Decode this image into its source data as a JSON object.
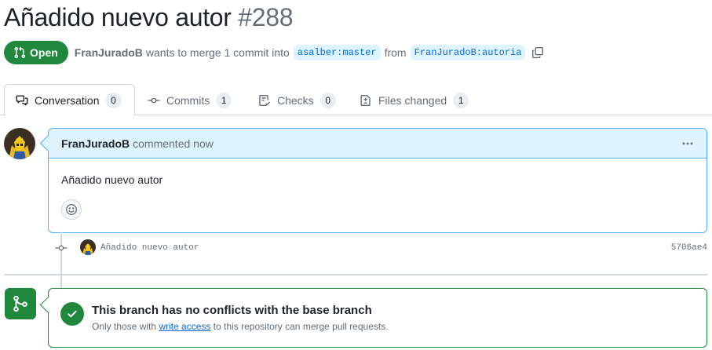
{
  "pr": {
    "title": "Añadido nuevo autor",
    "number": "#288",
    "state": "Open",
    "author": "FranJuradoB",
    "merge_text": "wants to merge 1 commit into",
    "base_branch": "asalber:master",
    "from_text": "from",
    "head_branch": "FranJuradoB:autoria"
  },
  "tabs": [
    {
      "label": "Conversation",
      "count": "0",
      "icon": "comment-discussion-icon"
    },
    {
      "label": "Commits",
      "count": "1",
      "icon": "git-commit-icon"
    },
    {
      "label": "Checks",
      "count": "0",
      "icon": "checklist-icon"
    },
    {
      "label": "Files changed",
      "count": "1",
      "icon": "file-diff-icon"
    }
  ],
  "comment": {
    "author": "FranJuradoB",
    "meta": "commented now",
    "body": "Añadido nuevo autor"
  },
  "commit": {
    "message": "Añadido nuevo autor",
    "sha": "5706ae4"
  },
  "merge": {
    "title": "This branch has no conflicts with the base branch",
    "sub_prefix": "Only those with",
    "sub_link": "write access",
    "sub_suffix": "to this repository can merge pull requests."
  },
  "colors": {
    "open_green": "#1f883d",
    "link_blue": "#0969da",
    "header_blue": "#ddf4ff"
  }
}
